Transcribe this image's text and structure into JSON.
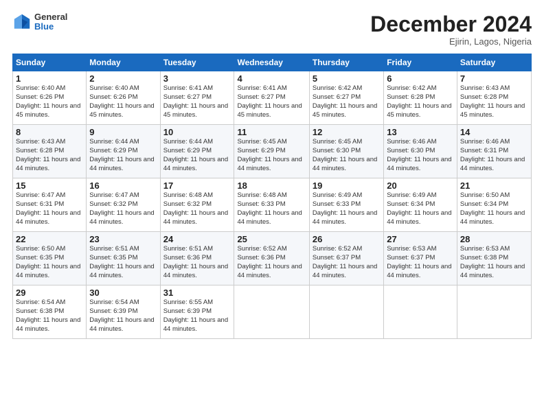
{
  "logo": {
    "general": "General",
    "blue": "Blue"
  },
  "title": "December 2024",
  "subtitle": "Ejirin, Lagos, Nigeria",
  "headers": [
    "Sunday",
    "Monday",
    "Tuesday",
    "Wednesday",
    "Thursday",
    "Friday",
    "Saturday"
  ],
  "weeks": [
    [
      {
        "day": "1",
        "sunrise": "6:40 AM",
        "sunset": "6:26 PM",
        "daylight": "11 hours and 45 minutes."
      },
      {
        "day": "2",
        "sunrise": "6:40 AM",
        "sunset": "6:26 PM",
        "daylight": "11 hours and 45 minutes."
      },
      {
        "day": "3",
        "sunrise": "6:41 AM",
        "sunset": "6:27 PM",
        "daylight": "11 hours and 45 minutes."
      },
      {
        "day": "4",
        "sunrise": "6:41 AM",
        "sunset": "6:27 PM",
        "daylight": "11 hours and 45 minutes."
      },
      {
        "day": "5",
        "sunrise": "6:42 AM",
        "sunset": "6:27 PM",
        "daylight": "11 hours and 45 minutes."
      },
      {
        "day": "6",
        "sunrise": "6:42 AM",
        "sunset": "6:28 PM",
        "daylight": "11 hours and 45 minutes."
      },
      {
        "day": "7",
        "sunrise": "6:43 AM",
        "sunset": "6:28 PM",
        "daylight": "11 hours and 45 minutes."
      }
    ],
    [
      {
        "day": "8",
        "sunrise": "6:43 AM",
        "sunset": "6:28 PM",
        "daylight": "11 hours and 44 minutes."
      },
      {
        "day": "9",
        "sunrise": "6:44 AM",
        "sunset": "6:29 PM",
        "daylight": "11 hours and 44 minutes."
      },
      {
        "day": "10",
        "sunrise": "6:44 AM",
        "sunset": "6:29 PM",
        "daylight": "11 hours and 44 minutes."
      },
      {
        "day": "11",
        "sunrise": "6:45 AM",
        "sunset": "6:29 PM",
        "daylight": "11 hours and 44 minutes."
      },
      {
        "day": "12",
        "sunrise": "6:45 AM",
        "sunset": "6:30 PM",
        "daylight": "11 hours and 44 minutes."
      },
      {
        "day": "13",
        "sunrise": "6:46 AM",
        "sunset": "6:30 PM",
        "daylight": "11 hours and 44 minutes."
      },
      {
        "day": "14",
        "sunrise": "6:46 AM",
        "sunset": "6:31 PM",
        "daylight": "11 hours and 44 minutes."
      }
    ],
    [
      {
        "day": "15",
        "sunrise": "6:47 AM",
        "sunset": "6:31 PM",
        "daylight": "11 hours and 44 minutes."
      },
      {
        "day": "16",
        "sunrise": "6:47 AM",
        "sunset": "6:32 PM",
        "daylight": "11 hours and 44 minutes."
      },
      {
        "day": "17",
        "sunrise": "6:48 AM",
        "sunset": "6:32 PM",
        "daylight": "11 hours and 44 minutes."
      },
      {
        "day": "18",
        "sunrise": "6:48 AM",
        "sunset": "6:33 PM",
        "daylight": "11 hours and 44 minutes."
      },
      {
        "day": "19",
        "sunrise": "6:49 AM",
        "sunset": "6:33 PM",
        "daylight": "11 hours and 44 minutes."
      },
      {
        "day": "20",
        "sunrise": "6:49 AM",
        "sunset": "6:34 PM",
        "daylight": "11 hours and 44 minutes."
      },
      {
        "day": "21",
        "sunrise": "6:50 AM",
        "sunset": "6:34 PM",
        "daylight": "11 hours and 44 minutes."
      }
    ],
    [
      {
        "day": "22",
        "sunrise": "6:50 AM",
        "sunset": "6:35 PM",
        "daylight": "11 hours and 44 minutes."
      },
      {
        "day": "23",
        "sunrise": "6:51 AM",
        "sunset": "6:35 PM",
        "daylight": "11 hours and 44 minutes."
      },
      {
        "day": "24",
        "sunrise": "6:51 AM",
        "sunset": "6:36 PM",
        "daylight": "11 hours and 44 minutes."
      },
      {
        "day": "25",
        "sunrise": "6:52 AM",
        "sunset": "6:36 PM",
        "daylight": "11 hours and 44 minutes."
      },
      {
        "day": "26",
        "sunrise": "6:52 AM",
        "sunset": "6:37 PM",
        "daylight": "11 hours and 44 minutes."
      },
      {
        "day": "27",
        "sunrise": "6:53 AM",
        "sunset": "6:37 PM",
        "daylight": "11 hours and 44 minutes."
      },
      {
        "day": "28",
        "sunrise": "6:53 AM",
        "sunset": "6:38 PM",
        "daylight": "11 hours and 44 minutes."
      }
    ],
    [
      {
        "day": "29",
        "sunrise": "6:54 AM",
        "sunset": "6:38 PM",
        "daylight": "11 hours and 44 minutes."
      },
      {
        "day": "30",
        "sunrise": "6:54 AM",
        "sunset": "6:39 PM",
        "daylight": "11 hours and 44 minutes."
      },
      {
        "day": "31",
        "sunrise": "6:55 AM",
        "sunset": "6:39 PM",
        "daylight": "11 hours and 44 minutes."
      },
      null,
      null,
      null,
      null
    ]
  ]
}
